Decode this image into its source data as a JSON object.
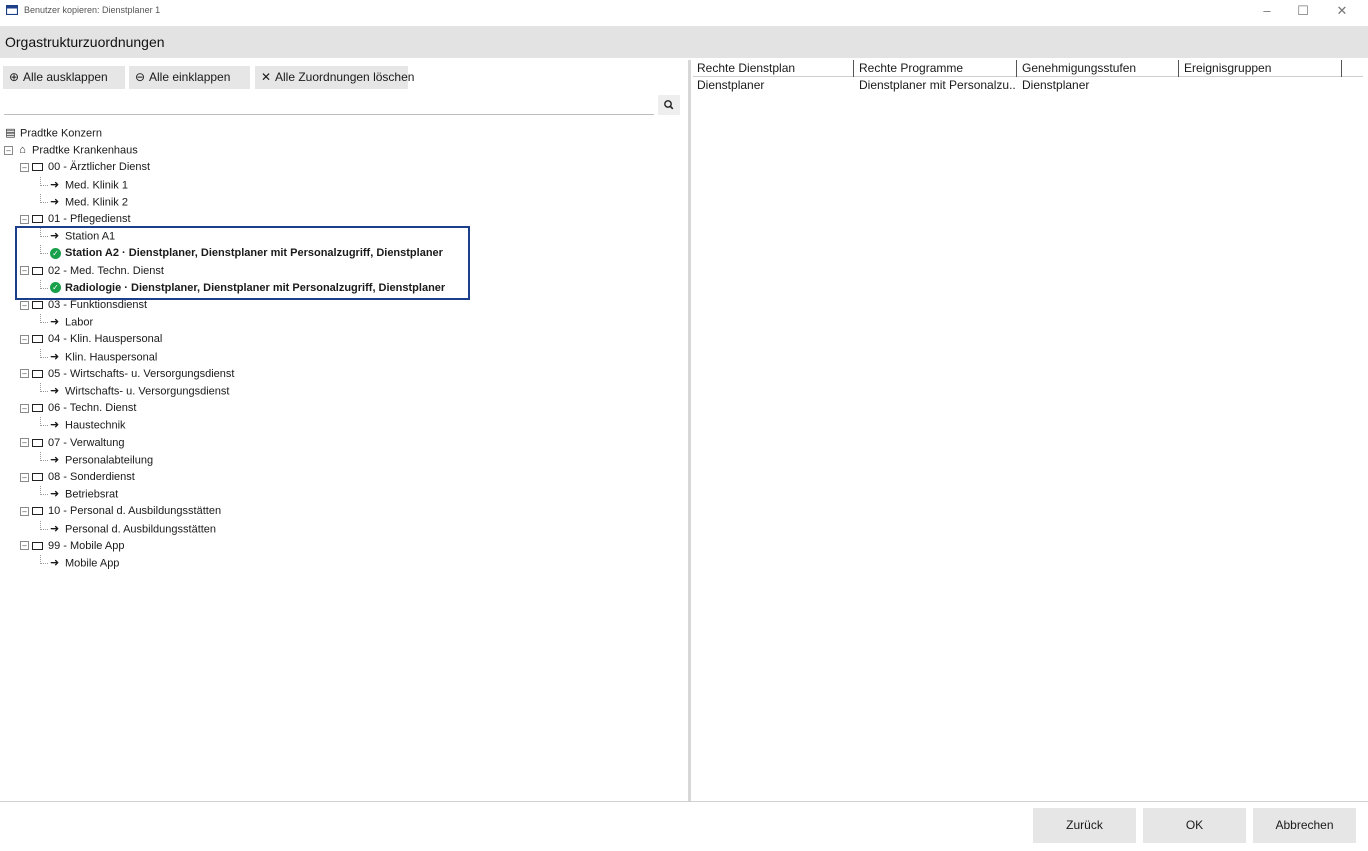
{
  "window": {
    "title": "Benutzer kopieren: Dienstplaner 1",
    "controls": {
      "minimize": "–",
      "maximize": "☐",
      "close": "✕"
    }
  },
  "section": {
    "title": "Orgastrukturzuordnungen"
  },
  "toolbar": {
    "expand_all": "Alle ausklappen",
    "collapse_all": "Alle einklappen",
    "clear_all": "Alle Zuordnungen löschen"
  },
  "search": {
    "value": "",
    "placeholder": ""
  },
  "tree": [
    {
      "level": 0,
      "icon": "building-icon",
      "label": "Pradtke Konzern",
      "bold": false
    },
    {
      "level": 0,
      "icon": "home-icon",
      "label": "Pradtke Krankenhaus",
      "bold": false,
      "expander": "⊟"
    },
    {
      "level": 1,
      "icon": "folder-icon",
      "label": "00 - Ärztlicher Dienst",
      "expander": "⊟"
    },
    {
      "level": 2,
      "icon": "arrow-icon",
      "label": "Med. Klinik 1"
    },
    {
      "level": 2,
      "icon": "arrow-icon",
      "label": "Med. Klinik 2"
    },
    {
      "level": 1,
      "icon": "folder-icon",
      "label": "01 - Pflegedienst",
      "expander": "⊟"
    },
    {
      "level": 2,
      "icon": "arrow-icon",
      "label": "Station A1"
    },
    {
      "level": 2,
      "icon": "check-icon",
      "label": "Station A2 · Dienstplaner, Dienstplaner mit Personalzugriff, Dienstplaner",
      "bold": true
    },
    {
      "level": 1,
      "icon": "folder-icon",
      "label": "02 - Med. Techn. Dienst",
      "expander": "⊟"
    },
    {
      "level": 2,
      "icon": "check-icon",
      "label": "Radiologie · Dienstplaner, Dienstplaner mit Personalzugriff, Dienstplaner",
      "bold": true
    },
    {
      "level": 1,
      "icon": "folder-icon",
      "label": "03 - Funktionsdienst",
      "expander": "⊟"
    },
    {
      "level": 2,
      "icon": "arrow-icon",
      "label": "Labor"
    },
    {
      "level": 1,
      "icon": "folder-icon",
      "label": "04 - Klin. Hauspersonal",
      "expander": "⊟"
    },
    {
      "level": 2,
      "icon": "arrow-icon",
      "label": "Klin. Hauspersonal"
    },
    {
      "level": 1,
      "icon": "folder-icon",
      "label": "05 - Wirtschafts- u. Versorgungsdienst",
      "expander": "⊟"
    },
    {
      "level": 2,
      "icon": "arrow-icon",
      "label": "Wirtschafts- u. Versorgungsdienst"
    },
    {
      "level": 1,
      "icon": "folder-icon",
      "label": "06 - Techn. Dienst",
      "expander": "⊟"
    },
    {
      "level": 2,
      "icon": "arrow-icon",
      "label": "Haustechnik"
    },
    {
      "level": 1,
      "icon": "folder-icon",
      "label": "07 - Verwaltung",
      "expander": "⊟"
    },
    {
      "level": 2,
      "icon": "arrow-icon",
      "label": "Personalabteilung"
    },
    {
      "level": 1,
      "icon": "folder-icon",
      "label": "08 - Sonderdienst",
      "expander": "⊟"
    },
    {
      "level": 2,
      "icon": "arrow-icon",
      "label": "Betriebsrat"
    },
    {
      "level": 1,
      "icon": "folder-icon",
      "label": "10 - Personal d. Ausbildungsstätten",
      "expander": "⊟"
    },
    {
      "level": 2,
      "icon": "arrow-icon",
      "label": "Personal d. Ausbildungsstätten"
    },
    {
      "level": 1,
      "icon": "folder-icon",
      "label": "99 - Mobile App",
      "expander": "⊟"
    },
    {
      "level": 2,
      "icon": "arrow-icon",
      "label": "Mobile App"
    }
  ],
  "grid": {
    "columns": [
      "Rechte Dienstplan",
      "Rechte Programme",
      "Genehmigungsstufen",
      "Ereignisgruppen"
    ],
    "rows": [
      [
        "Dienstplaner",
        "Dienstplaner mit Personalzu...",
        "Dienstplaner",
        ""
      ]
    ]
  },
  "footer": {
    "back": "Zurück",
    "ok": "OK",
    "cancel": "Abbrechen"
  },
  "colors": {
    "highlight_border": "#1b3f8b",
    "check_green": "#18a04a"
  }
}
